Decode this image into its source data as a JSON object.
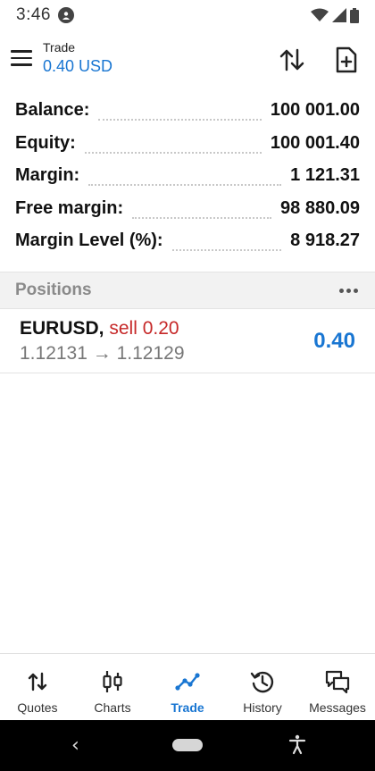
{
  "status_bar": {
    "time": "3:46"
  },
  "app_bar": {
    "title": "Trade",
    "subtitle": "0.40 USD"
  },
  "summary": [
    {
      "label": "Balance:",
      "value": "100 001.00"
    },
    {
      "label": "Equity:",
      "value": "100 001.40"
    },
    {
      "label": "Margin:",
      "value": "1 121.31"
    },
    {
      "label": "Free margin:",
      "value": "98 880.09"
    },
    {
      "label": "Margin Level (%):",
      "value": "8 918.27"
    }
  ],
  "positions": {
    "title": "Positions",
    "items": [
      {
        "symbol": "EURUSD,",
        "side": "sell 0.20",
        "open_price": "1.12131",
        "arrow": "→",
        "current_price": "1.12129",
        "profit": "0.40"
      }
    ]
  },
  "bottom_nav": {
    "items": [
      {
        "label": "Quotes",
        "icon": "quotes-icon"
      },
      {
        "label": "Charts",
        "icon": "charts-icon"
      },
      {
        "label": "Trade",
        "icon": "trade-icon",
        "active": true
      },
      {
        "label": "History",
        "icon": "history-icon"
      },
      {
        "label": "Messages",
        "icon": "messages-icon"
      }
    ]
  },
  "colors": {
    "accent": "#1976d2",
    "sell": "#c62828",
    "muted": "#777777"
  }
}
